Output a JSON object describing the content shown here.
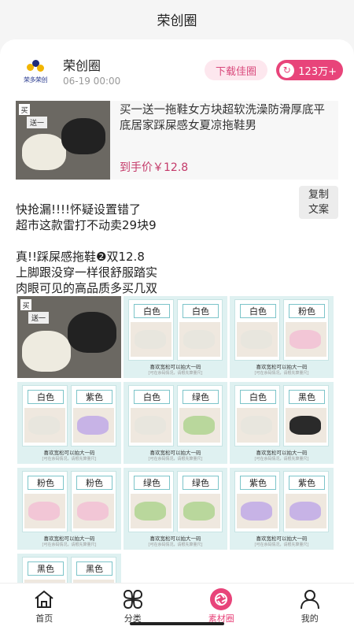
{
  "app": {
    "title": "荣创圈"
  },
  "post": {
    "shop_name": "荣创圈",
    "time": "06-19 00:00",
    "logo_text": "荣多荣创",
    "download_label": "下载佳圈",
    "share_count": "123万+",
    "copy_label_line1": "复制",
    "copy_label_line2": "文案",
    "product": {
      "title": "买一送一拖鞋女方块超软洗澡防滑厚底平底居家踩屎感女夏凉拖鞋男",
      "price": "到手价￥12.8",
      "badge_buy": "买",
      "badge_gift": "送一"
    },
    "text_lines": [
      "快抢漏!!!!怀疑设置错了",
      "超市这款雷打不动卖29块9",
      "真!!踩屎感拖鞋❷双12.8",
      "上脚跟没穿一样很舒服踏实",
      "肉眼可见的高品质多买几双"
    ],
    "grid_caption": "喜欢宽松可以拍大一码",
    "grid_subcaption": "[可在余码情况，请根先算量尺]",
    "grid": [
      {
        "type": "main"
      },
      {
        "left": "白色",
        "right": "白色",
        "lc": "#e8e6de",
        "rc": "#e8e6de"
      },
      {
        "left": "白色",
        "right": "粉色",
        "lc": "#e8e6de",
        "rc": "#f2c6d6"
      },
      {
        "left": "白色",
        "right": "紫色",
        "lc": "#e8e6de",
        "rc": "#c7b3e6"
      },
      {
        "left": "白色",
        "right": "绿色",
        "lc": "#e8e6de",
        "rc": "#b9d79c"
      },
      {
        "left": "白色",
        "right": "黑色",
        "lc": "#e8e6de",
        "rc": "#2a2a2a"
      },
      {
        "left": "粉色",
        "right": "粉色",
        "lc": "#f2c6d6",
        "rc": "#f2c6d6"
      },
      {
        "left": "绿色",
        "right": "绿色",
        "lc": "#b9d79c",
        "rc": "#b9d79c"
      },
      {
        "left": "紫色",
        "right": "紫色",
        "lc": "#c7b3e6",
        "rc": "#c7b3e6"
      },
      {
        "left": "黑色",
        "right": "黑色",
        "lc": "#2a2a2a",
        "rc": "#2a2a2a"
      }
    ]
  },
  "tabs": [
    {
      "label": "首页",
      "icon": "home-icon"
    },
    {
      "label": "分类",
      "icon": "category-icon"
    },
    {
      "label": "素材圈",
      "icon": "material-circle-icon"
    },
    {
      "label": "我的",
      "icon": "profile-icon"
    }
  ],
  "colors": {
    "accent": "#e8447a",
    "price": "#c43a6a"
  }
}
